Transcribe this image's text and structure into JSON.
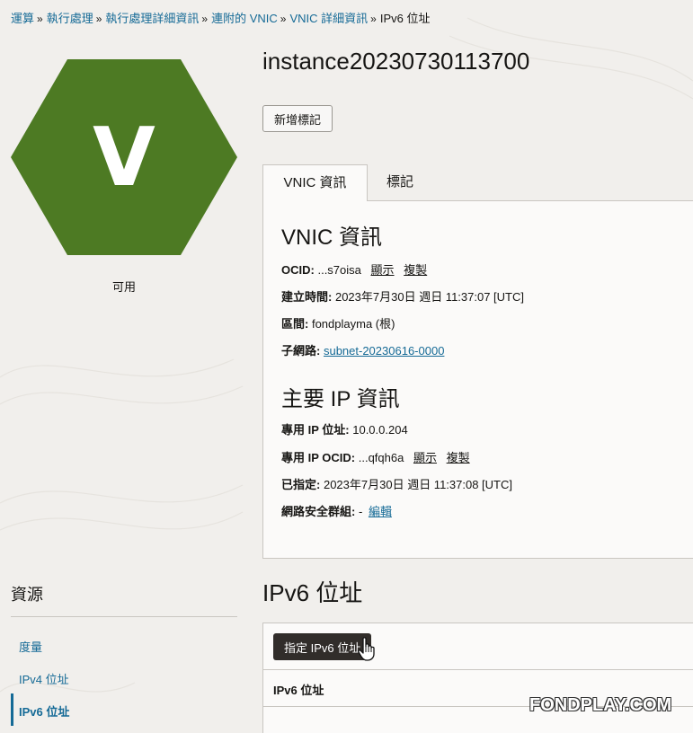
{
  "breadcrumb": [
    {
      "label": "運算",
      "link": true
    },
    {
      "label": "執行處理",
      "link": true
    },
    {
      "label": "執行處理詳細資訊",
      "link": true
    },
    {
      "label": "連附的 VNIC",
      "link": true
    },
    {
      "label": "VNIC 詳細資訊",
      "link": true
    },
    {
      "label": "IPv6 位址",
      "link": false
    }
  ],
  "breadcrumb_separator": "»",
  "badge": {
    "letter": "V",
    "color": "#4d7a23",
    "status": "可用"
  },
  "instance": {
    "title": "instance20230730113700",
    "add_tag_label": "新增標記"
  },
  "tabs": [
    {
      "label": "VNIC 資訊",
      "active": true
    },
    {
      "label": "標記",
      "active": false
    }
  ],
  "vnic_info": {
    "heading": "VNIC 資訊",
    "ocid_label": "OCID:",
    "ocid_value": "...s7oisa",
    "show_label": "顯示",
    "copy_label": "複製",
    "created_label": "建立時間:",
    "created_value": "2023年7月30日 週日 11:37:07 [UTC]",
    "compartment_label": "區間:",
    "compartment_value": "fondplayma (根)",
    "subnet_label": "子網路:",
    "subnet_value": "subnet-20230616-0000"
  },
  "primary_ip": {
    "heading": "主要 IP 資訊",
    "private_ip_label": "專用 IP 位址:",
    "private_ip_value": "10.0.0.204",
    "private_ocid_label": "專用 IP OCID:",
    "private_ocid_value": "...qfqh6a",
    "show_label": "顯示",
    "copy_label": "複製",
    "assigned_label": "已指定:",
    "assigned_value": "2023年7月30日 週日 11:37:08 [UTC]",
    "nsg_label": "網路安全群組:",
    "nsg_value": "-",
    "edit_label": "編輯"
  },
  "resources": {
    "title": "資源",
    "items": [
      {
        "label": "度量",
        "active": false
      },
      {
        "label": "IPv4 位址",
        "active": false
      },
      {
        "label": "IPv6 位址",
        "active": true
      }
    ]
  },
  "ipv6_section": {
    "title": "IPv6 位址",
    "assign_button": "指定 IPv6 位址",
    "column_header": "IPv6 位址"
  },
  "watermark": "FONDPLAY.COM",
  "colors": {
    "link": "#156a96",
    "badge_green": "#4d7a23",
    "primary_button": "#312d2a"
  }
}
